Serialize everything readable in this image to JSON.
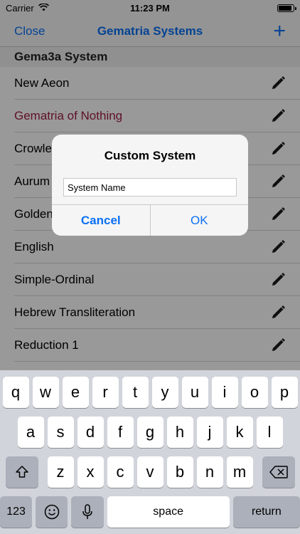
{
  "status_bar": {
    "carrier": "Carrier",
    "time": "11:23 PM",
    "battery_level": 0.95
  },
  "nav": {
    "close_label": "Close",
    "title": "Gematria Systems",
    "add_label": "+"
  },
  "section": {
    "header": "Gema3a System"
  },
  "rows": [
    {
      "label": "New Aeon",
      "selected": false
    },
    {
      "label": "Gematria of Nothing",
      "selected": true
    },
    {
      "label": "Crowle",
      "selected": false
    },
    {
      "label": "Aurum",
      "selected": false
    },
    {
      "label": "Golden",
      "selected": false
    },
    {
      "label": "English",
      "selected": false
    },
    {
      "label": "Simple-Ordinal",
      "selected": false
    },
    {
      "label": "Hebrew Transliteration",
      "selected": false
    },
    {
      "label": "Reduction 1",
      "selected": false
    }
  ],
  "alert": {
    "title": "Custom System",
    "input_placeholder": "System Name",
    "cancel_label": "Cancel",
    "ok_label": "OK"
  },
  "keyboard": {
    "row1": [
      "q",
      "w",
      "e",
      "r",
      "t",
      "y",
      "u",
      "i",
      "o",
      "p"
    ],
    "row2": [
      "a",
      "s",
      "d",
      "f",
      "g",
      "h",
      "j",
      "k",
      "l"
    ],
    "row3": [
      "z",
      "x",
      "c",
      "v",
      "b",
      "n",
      "m"
    ],
    "numbers_label": "123",
    "space_label": "space",
    "return_label": "return"
  },
  "colors": {
    "accent": "#0a70f5",
    "selected_row": "#a11d45",
    "keyboard_bg": "#d1d4da"
  }
}
